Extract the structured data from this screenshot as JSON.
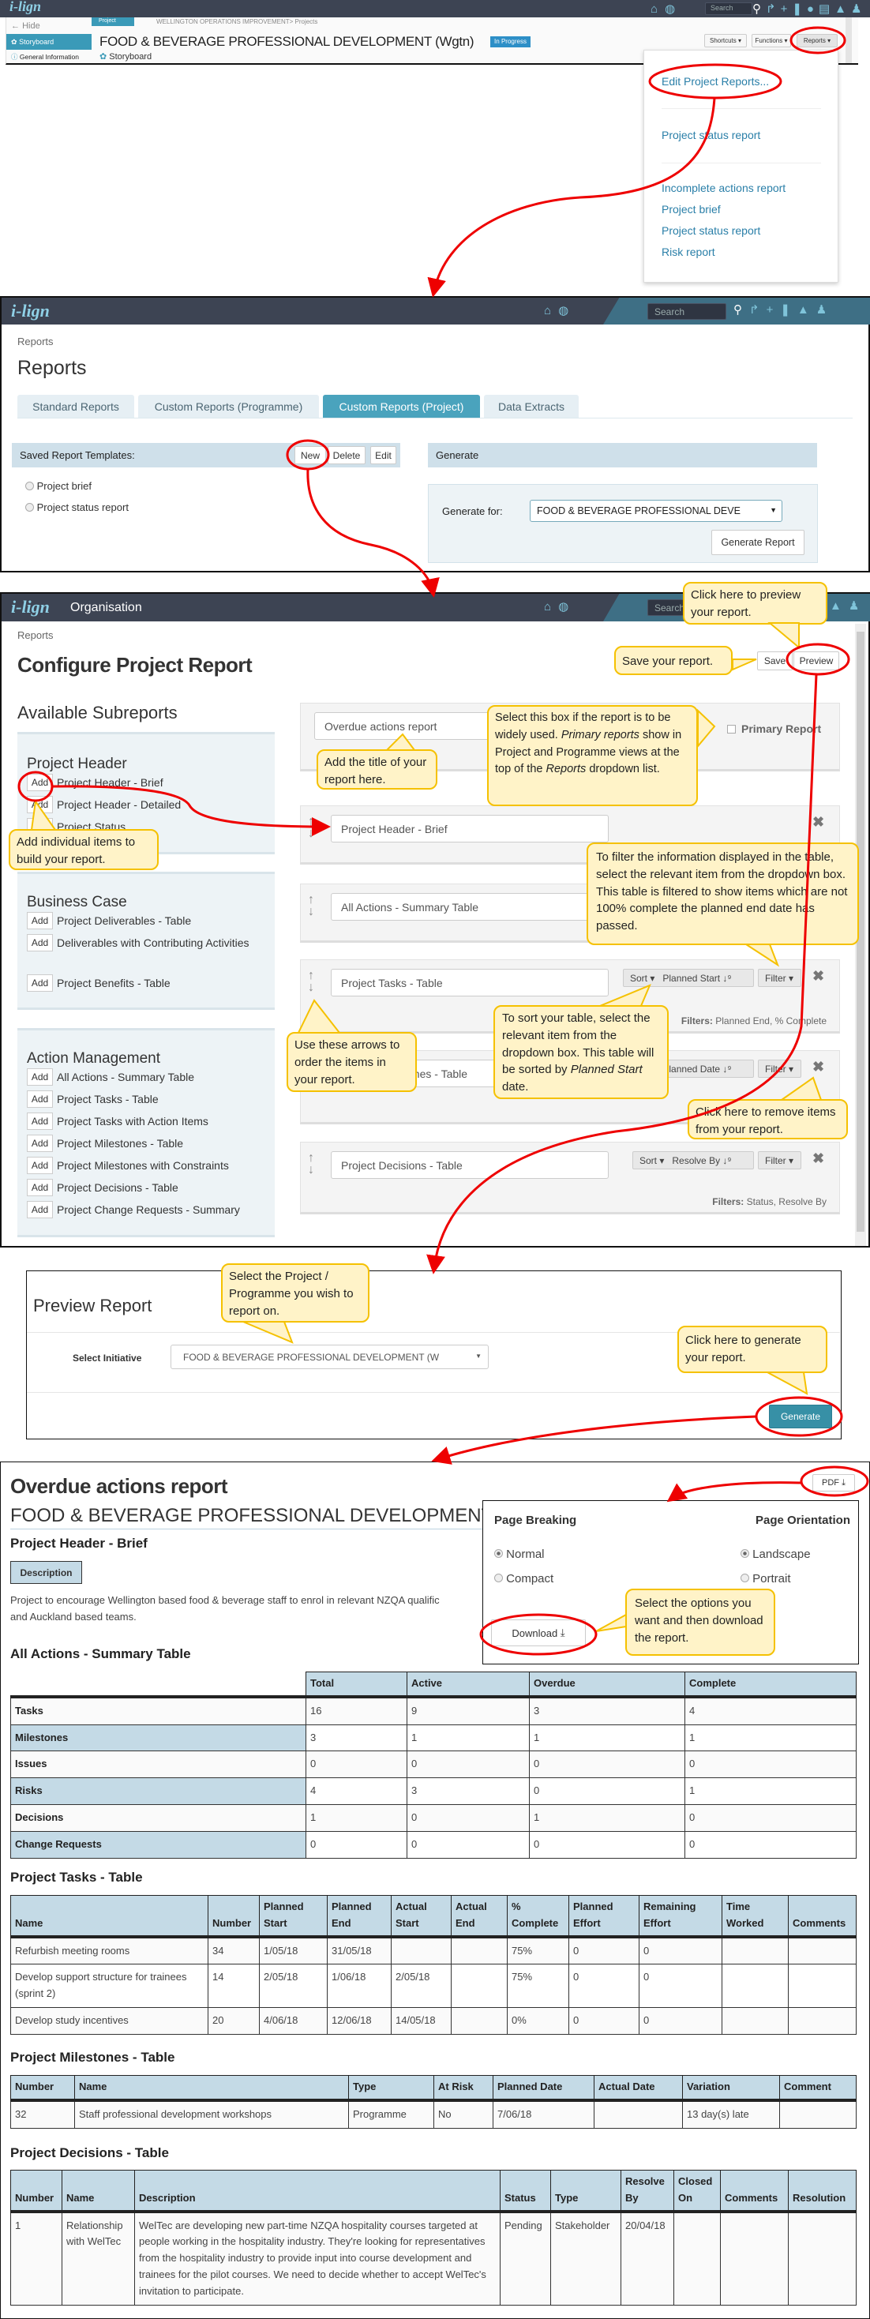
{
  "colors": {
    "topbar": "#3d4453",
    "accent": "#4aa3bd",
    "panel": "#cfe0ea",
    "callout_bg": "#fff3c8",
    "callout_border": "#f5c100",
    "annotation": "#e00000"
  },
  "brand": "i-lign",
  "topbar_icons": [
    "home-icon",
    "globe-icon",
    "share-icon",
    "plus-icon",
    "bookmark-icon",
    "comment-icon",
    "document-icon",
    "bell-icon",
    "user-icon"
  ],
  "search_placeholder": "Search",
  "s1": {
    "hide": "Hide",
    "nav": [
      {
        "label": "Storyboard",
        "icon": "storyboard-icon"
      },
      {
        "label": "General Information",
        "icon": "info-icon"
      }
    ],
    "tag": "Project",
    "breadcrumb": "WELLINGTON OPERATIONS IMPROVEMENT> Projects",
    "title": "FOOD & BEVERAGE PROFESSIONAL DEVELOPMENT (Wgtn)",
    "status": "In Progress",
    "subtitle": "Storyboard",
    "buttons": {
      "shortcuts": "Shortcuts ▾",
      "functions": "Functions ▾",
      "reports": "Reports ▾"
    },
    "menu": {
      "edit": "Edit Project Reports...",
      "group1": [
        "Project status report"
      ],
      "group2": [
        "Incomplete actions report",
        "Project brief",
        "Project status report",
        "Risk report"
      ]
    }
  },
  "s2": {
    "breadcrumb": "Reports",
    "title": "Reports",
    "tabs": [
      "Standard Reports",
      "Custom Reports (Programme)",
      "Custom Reports (Project)",
      "Data Extracts"
    ],
    "active_tab": "Custom Reports (Project)",
    "saved_label": "Saved Report Templates:",
    "new": "New",
    "delete": "Delete",
    "edit": "Edit",
    "templates": [
      "Project brief",
      "Project status report"
    ],
    "generate_header": "Generate",
    "generate_for_label": "Generate for:",
    "generate_for_value": "FOOD & BEVERAGE PROFESSIONAL DEVE",
    "generate_button": "Generate Report"
  },
  "s3": {
    "org": "Organisation",
    "breadcrumb": "Reports",
    "title": "Configure Project Report",
    "save": "Save",
    "preview": "Preview",
    "available": "Available Subreports",
    "groups": [
      {
        "name": "Project Header",
        "items": [
          "Project Header - Brief",
          "Project Header - Detailed",
          "Project Status"
        ]
      },
      {
        "name": "Business Case",
        "items": [
          "Project Deliverables - Table",
          "Deliverables with Contributing Activities",
          "Project Benefits - Table"
        ]
      },
      {
        "name": "Action Management",
        "items": [
          "All Actions - Summary Table",
          "Project Tasks - Table",
          "Project Tasks with Action Items",
          "Project Milestones - Table",
          "Project Milestones with Constraints",
          "Project Decisions - Table",
          "Project Change Requests - Summary"
        ]
      }
    ],
    "add": "Add",
    "report_title": "Overdue actions report",
    "primary": "Primary Report",
    "items": [
      {
        "name": "Project Header - Brief"
      },
      {
        "name": "All Actions - Summary Table"
      },
      {
        "name": "Project Tasks - Table",
        "sort": "Planned Start",
        "filters": "Planned End, % Complete"
      },
      {
        "name": "Project Milestones - Table",
        "sort": "Planned Date"
      },
      {
        "name": "Project Decisions - Table",
        "sort": "Resolve By",
        "filters": "Status, Resolve By"
      }
    ],
    "sort_label": "Sort ▾",
    "filter_label": "Filter ▾",
    "filters_prefix": "Filters:"
  },
  "callouts": {
    "preview": "Click here to preview your report.",
    "save": "Save your report.",
    "title": "Add the title of your report here.",
    "primary_1": "Select this box if the report is to be widely used.",
    "primary_2": "Primary reports",
    "primary_3": "show in Project and Programme views at the top of the",
    "primary_4": "Reports",
    "primary_5": "dropdown list.",
    "add": "Add individual items to build your report.",
    "filter": "To filter the information displayed in the table, select the relevant item from the dropdown box. This table is filtered  to show items which are not 100% complete the planned end date has passed.",
    "sort_1": "To sort your table, select the relevant item from the dropdown box. This table will be sorted by",
    "sort_2": "Planned Start",
    "sort_3": "date.",
    "arrows": "Use these arrows to order the items in your report.",
    "remove": "Click here to remove items from your report.",
    "select": "Select the Project / Programme you wish to report on.",
    "generate": "Click here to generate your report.",
    "download": "Select the options you want and then download the report."
  },
  "s4": {
    "title": "Preview Report",
    "label": "Select Initiative",
    "value": "FOOD & BEVERAGE PROFESSIONAL DEVELOPMENT (W",
    "button": "Generate"
  },
  "s5": {
    "title": "Overdue actions report",
    "pdf": "PDF",
    "project": "FOOD & BEVERAGE PROFESSIONAL DEVELOPMENT (W",
    "header_title": "Project Header - Brief",
    "desc_label": "Description",
    "desc_1": "Project to encourage Wellington based food & beverage staff to enrol in relevant NZQA qualific",
    "desc_2": "and Auckland based teams.",
    "popup": {
      "breaking": "Page Breaking",
      "orientation": "Page Orientation",
      "normal": "Normal",
      "compact": "Compact",
      "landscape": "Landscape",
      "portrait": "Portrait",
      "download": "Download",
      "breaking_selected": "Normal",
      "orientation_selected": "Landscape"
    },
    "summary": {
      "title": "All Actions - Summary Table",
      "columns": [
        "Total",
        "Active",
        "Overdue",
        "Complete"
      ],
      "rows": [
        [
          "Tasks",
          "16",
          "9",
          "3",
          "4"
        ],
        [
          "Milestones",
          "3",
          "1",
          "1",
          "1"
        ],
        [
          "Issues",
          "0",
          "0",
          "0",
          "0"
        ],
        [
          "Risks",
          "4",
          "3",
          "0",
          "1"
        ],
        [
          "Decisions",
          "1",
          "0",
          "1",
          "0"
        ],
        [
          "Change Requests",
          "0",
          "0",
          "0",
          "0"
        ]
      ]
    },
    "tasks": {
      "title": "Project Tasks - Table",
      "columns": [
        "Name",
        "Number",
        "Planned Start",
        "Planned End",
        "Actual Start",
        "Actual End",
        "% Complete",
        "Planned Effort",
        "Remaining Effort",
        "Time Worked",
        "Comments"
      ],
      "rows": [
        [
          "Refurbish meeting rooms",
          "34",
          "1/05/18",
          "31/05/18",
          "",
          "",
          "75%",
          "0",
          "0",
          "",
          ""
        ],
        [
          "Develop support structure for trainees (sprint 2)",
          "14",
          "2/05/18",
          "1/06/18",
          "2/05/18",
          "",
          "75%",
          "0",
          "0",
          "",
          ""
        ],
        [
          "Develop study incentives",
          "20",
          "4/06/18",
          "12/06/18",
          "14/05/18",
          "",
          "0%",
          "0",
          "0",
          "",
          ""
        ]
      ]
    },
    "milestones": {
      "title": "Project Milestones - Table",
      "columns": [
        "Number",
        "Name",
        "Type",
        "At Risk",
        "Planned Date",
        "Actual Date",
        "Variation",
        "Comment"
      ],
      "rows": [
        [
          "32",
          "Staff professional development workshops",
          "Programme",
          "No",
          "7/06/18",
          "",
          "13 day(s) late",
          ""
        ]
      ]
    },
    "decisions": {
      "title": "Project Decisions - Table",
      "columns": [
        "Number",
        "Name",
        "Description",
        "Status",
        "Type",
        "Resolve By",
        "Closed On",
        "Comments",
        "Resolution"
      ],
      "rows": [
        [
          "1",
          "Relationship with WelTec",
          "WelTec are developing new part-time NZQA hospitality courses targeted at people working in the hospitality industry. They're looking for representatives from the hospitality industry to provide input into course development and trainees for the pilot courses. We need to decide whether to accept WelTec's invitation to participate.",
          "Pending",
          "Stakeholder",
          "20/04/18",
          "",
          "",
          ""
        ]
      ]
    }
  }
}
